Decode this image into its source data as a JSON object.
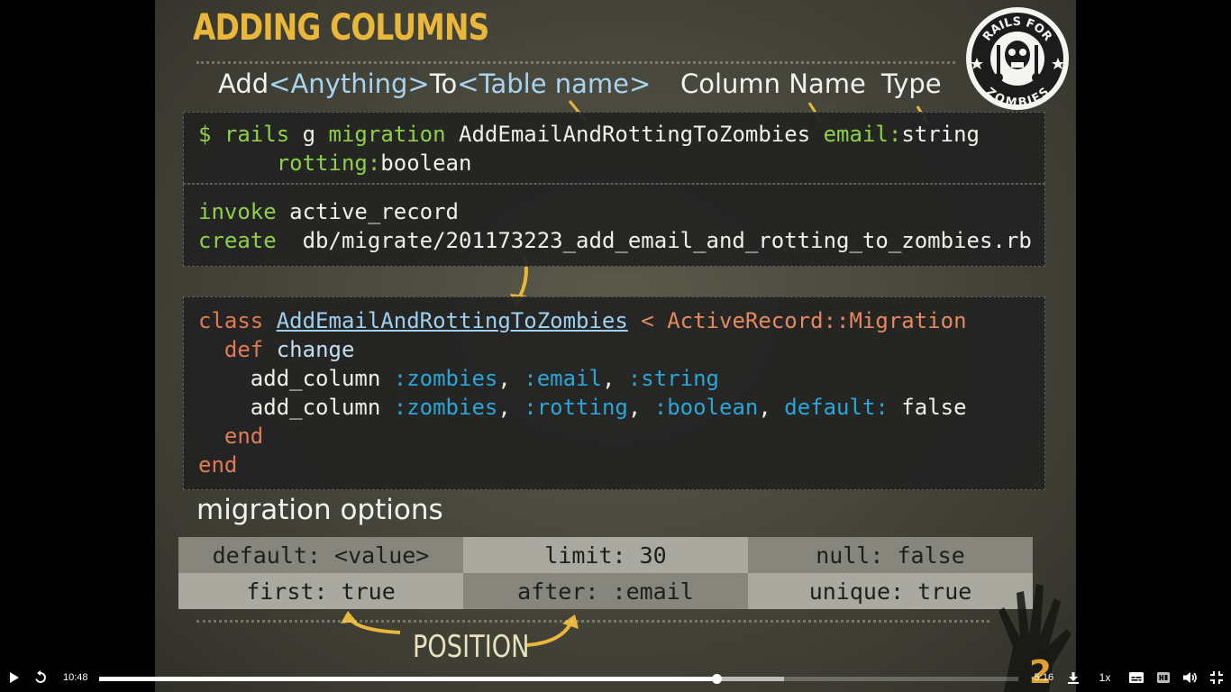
{
  "slide": {
    "title": "Adding Columns",
    "annotations": {
      "add": "Add",
      "anything": "<Anything>",
      "to": "To",
      "table_name": "<Table name>",
      "column_name": "Column Name",
      "type": "Type"
    },
    "command": {
      "prompt": "$",
      "rails": "rails",
      "g": "g",
      "migration": "migration",
      "name": "AddEmailAndRottingToZombies",
      "field1_name": "email:",
      "field1_type": "string",
      "field2_name": "rotting:",
      "field2_type": "boolean"
    },
    "output": {
      "invoke_kw": "invoke",
      "invoke_val": "active_record",
      "create_kw": "create",
      "create_val": "db/migrate/201173223_add_email_and_rotting_to_zombies.rb"
    },
    "code": {
      "class_kw": "class",
      "class_name": "AddEmailAndRottingToZombies",
      "superclass": "< ActiveRecord::Migration",
      "def_kw": "def",
      "method": "change",
      "add_column": "add_column",
      "line1_args": [
        ":zombies",
        ":email",
        ":string"
      ],
      "line2_args": [
        ":zombies",
        ":rotting",
        ":boolean"
      ],
      "default_kw": "default:",
      "default_val": "false",
      "end_kw": "end"
    },
    "options_title": "migration options",
    "options": [
      [
        "default: <value>",
        "limit: 30",
        "null: false"
      ],
      [
        "first: true",
        "after: :email",
        "unique: true"
      ]
    ],
    "position_label": "POSITION",
    "logo": {
      "top": "RAILS FOR",
      "bottom": "ZOMBIES"
    },
    "badge": "2"
  },
  "controls": {
    "elapsed": "10:48",
    "remaining": "-5:16",
    "speed": "1x",
    "progress_fraction": 0.672,
    "buffered_fraction": 0.745,
    "icons": [
      "play-icon",
      "replay-icon",
      "download-icon",
      "captions-icon",
      "hd-icon",
      "volume-icon",
      "exit-fullscreen-icon"
    ]
  },
  "colors": {
    "title": "#e9b73a",
    "code_green": "#8fd04a",
    "code_orange": "#e07c55",
    "code_blue": "#2aa6d8"
  }
}
